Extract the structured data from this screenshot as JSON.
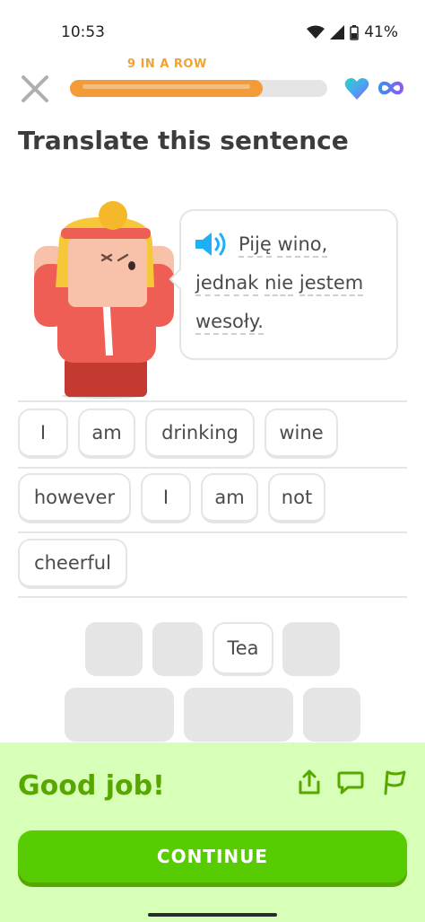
{
  "status_bar": {
    "time": "10:53",
    "battery": "41%"
  },
  "header": {
    "streak": "9 IN A ROW",
    "progress_fraction": 0.75
  },
  "prompt": {
    "title": "Translate this sentence"
  },
  "sentence": {
    "line1": [
      "Piję",
      "wino,"
    ],
    "line2": [
      "jednak",
      "nie",
      "jestem"
    ],
    "line3": [
      "wesoły."
    ]
  },
  "answer_tiles": {
    "row1": [
      "I",
      "am",
      "drinking",
      "wine"
    ],
    "row2": [
      "however",
      "I",
      "am",
      "not"
    ],
    "row3": [
      "cheerful"
    ]
  },
  "word_bank": {
    "remaining_tile": "Tea"
  },
  "feedback": {
    "message": "Good job!",
    "continue_label": "CONTINUE"
  },
  "colors": {
    "green": "#58cc02",
    "feedback_bg": "#d7ffb8",
    "streak": "#f0a334"
  }
}
